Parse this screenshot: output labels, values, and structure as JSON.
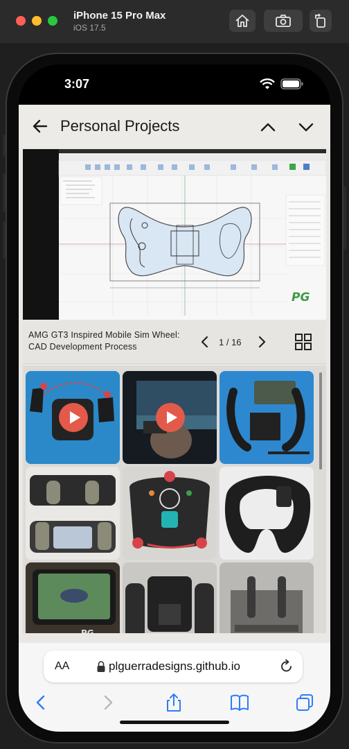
{
  "simulator": {
    "device_name": "iPhone 15 Pro Max",
    "os_version": "iOS 17.5",
    "buttons": [
      "home-icon",
      "screenshot-icon",
      "rotate-icon"
    ]
  },
  "status_bar": {
    "time": "3:07"
  },
  "lightbox": {
    "title": "Personal Projects",
    "caption": "AMG GT3 Inspired Mobile Sim Wheel: CAD Development Process",
    "counter": "1 / 16",
    "image_watermark": "PG"
  },
  "thumbnails": [
    {
      "label": "video-1",
      "play": true
    },
    {
      "label": "video-2",
      "play": true
    },
    {
      "label": "photo-3",
      "play": false
    },
    {
      "label": "photo-4",
      "play": false
    },
    {
      "label": "photo-5",
      "play": false
    },
    {
      "label": "photo-6",
      "play": false
    },
    {
      "label": "photo-7",
      "play": false
    },
    {
      "label": "photo-8",
      "play": false
    },
    {
      "label": "photo-9",
      "play": false
    }
  ],
  "safari": {
    "text_size": "AA",
    "url": "plguerradesigns.github.io"
  },
  "colors": {
    "accent_red": "#e35a4a",
    "header_bg": "#ecebe7"
  }
}
